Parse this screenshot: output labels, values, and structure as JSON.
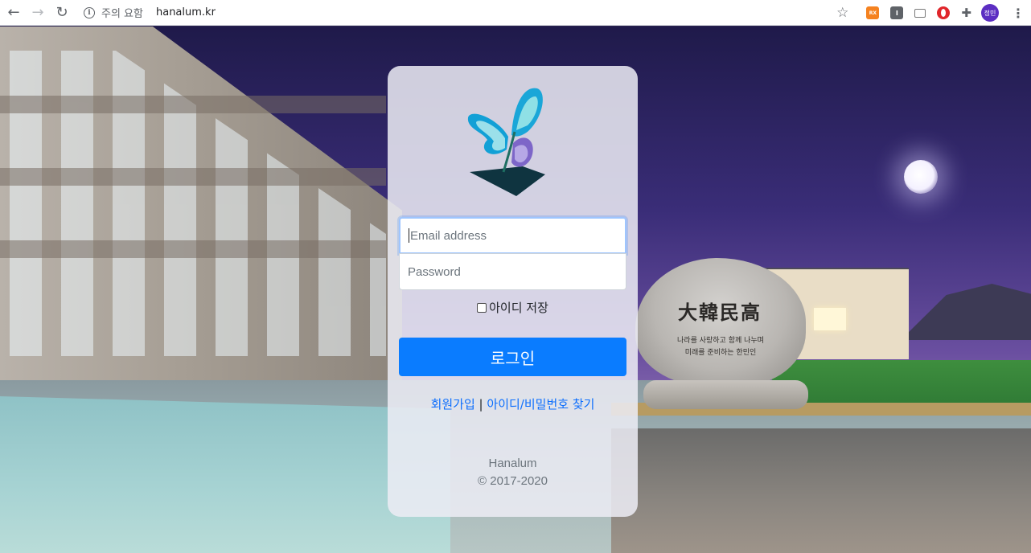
{
  "browser": {
    "security_label": "주의 요함",
    "url": "hanalum.kr",
    "extensions": [
      "RX",
      "I",
      "",
      ""
    ],
    "profile_label": "정민"
  },
  "login": {
    "email_placeholder": "Email address",
    "password_placeholder": "Password",
    "remember_label": "아이디 저장",
    "login_button": "로그인",
    "signup_link": "회원가입",
    "separator": "|",
    "find_account_link": "아이디/비밀번호 찾기",
    "footer_name": "Hanalum",
    "footer_copyright": "© 2017-2020"
  },
  "background": {
    "stone_title": "大韓民高",
    "stone_line1": "나라를 사랑하고 함께 나누며",
    "stone_line2": "미래를 준비하는 한민인"
  },
  "colors": {
    "primary": "#0a7cff",
    "link": "#0d6efd",
    "card_bg": "#ececf4"
  }
}
